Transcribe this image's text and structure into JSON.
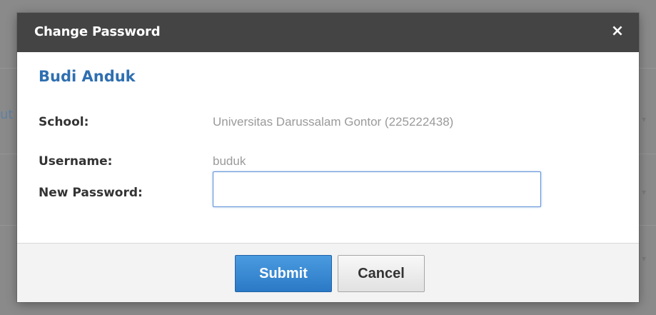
{
  "background": {
    "left_fragment": "ut"
  },
  "dialog": {
    "title": "Change Password",
    "close_icon": "×",
    "user_name": "Budi Anduk",
    "fields": {
      "school_label": "School:",
      "school_value": "Universitas Darussalam Gontor (225222438)",
      "username_label": "Username:",
      "username_value": "buduk",
      "new_password_label": "New Password:",
      "new_password_value": ""
    },
    "buttons": {
      "submit": "Submit",
      "cancel": "Cancel"
    }
  },
  "colors": {
    "titlebar": "#444444",
    "accent_name": "#2f6fb0",
    "submit_button": "#2b79c6",
    "overlay": "#8a8a8a"
  },
  "icons": {
    "close": "close-icon",
    "chevron": "chevron-down-icon"
  }
}
